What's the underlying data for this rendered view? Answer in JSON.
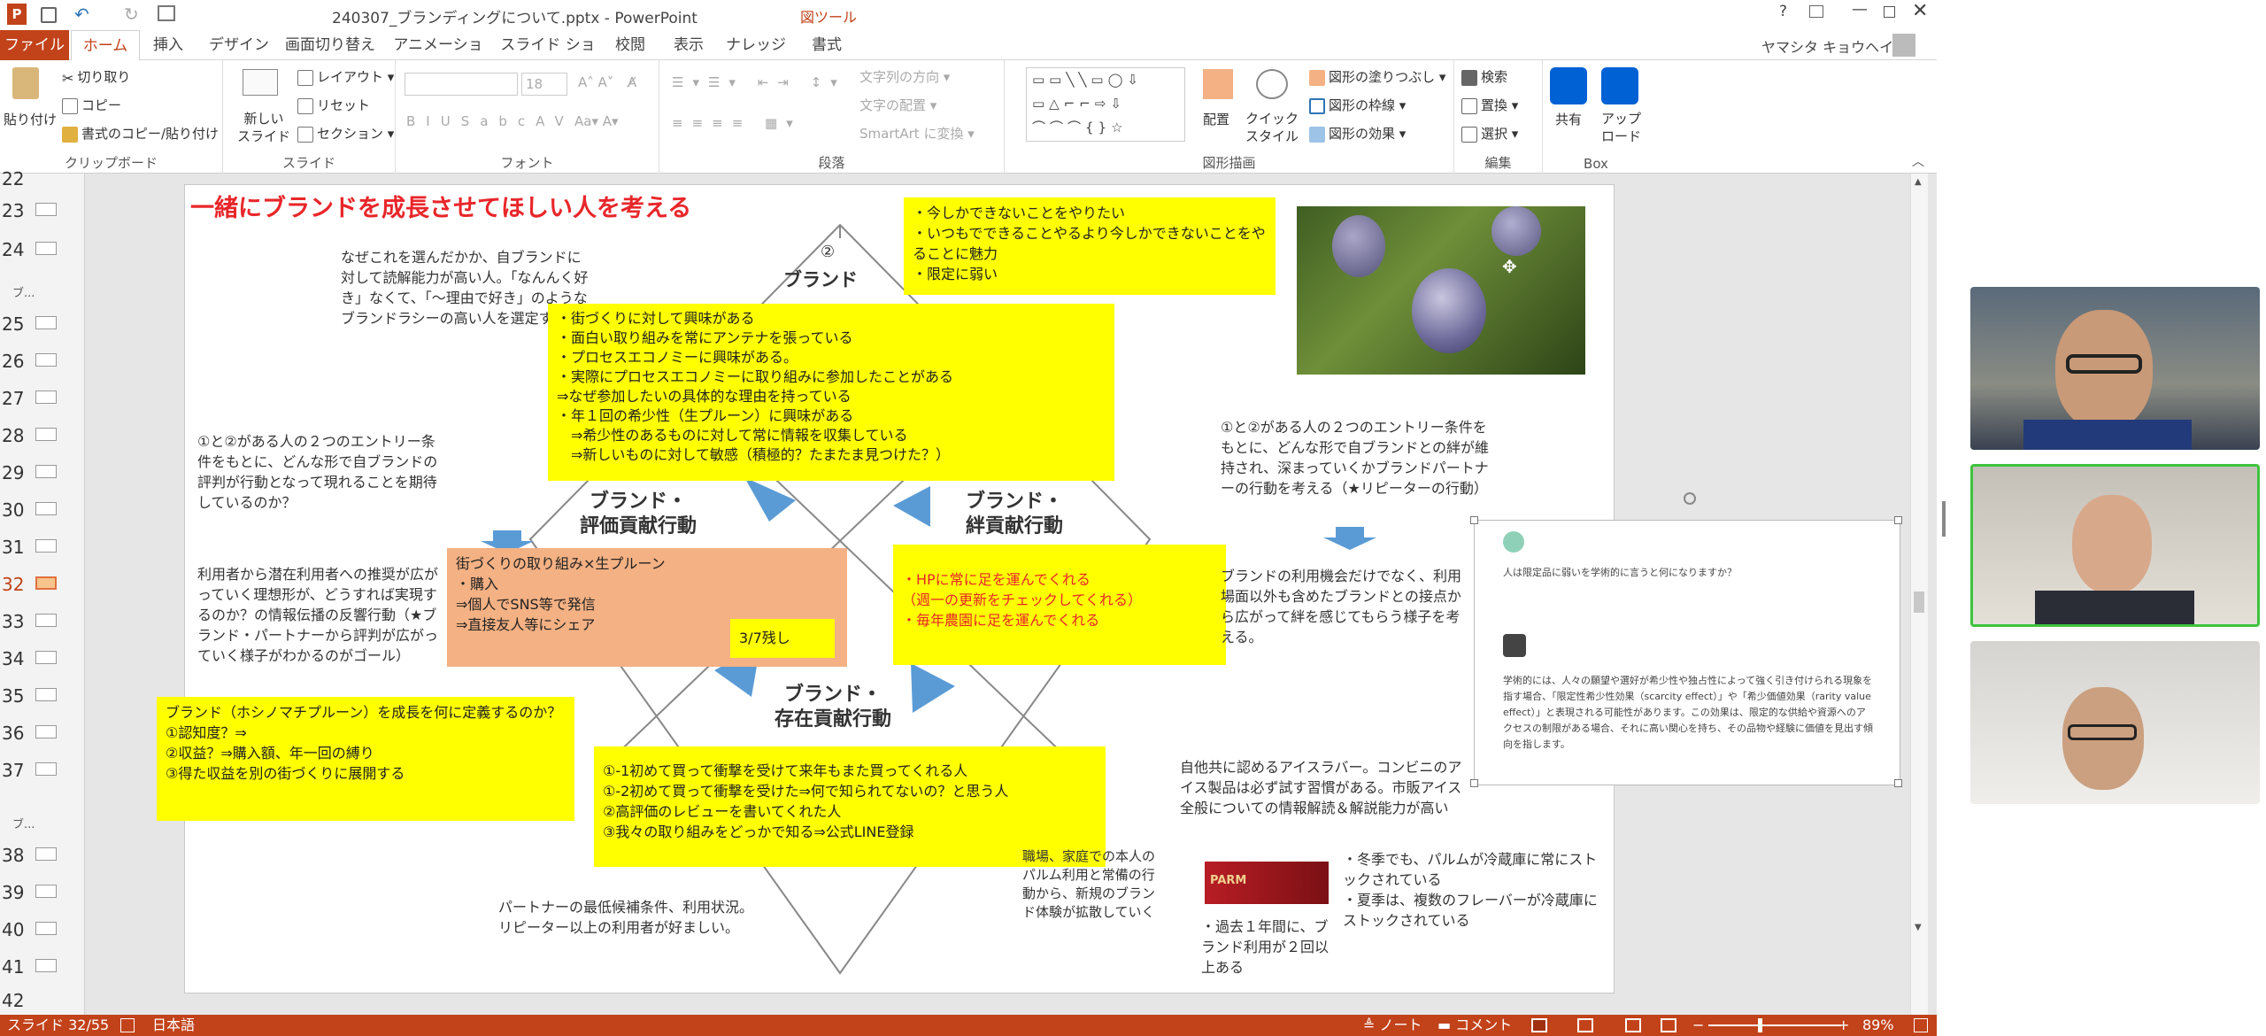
{
  "window": {
    "title": "240307_ブランディングについて.pptx - PowerPoint",
    "context_tab": "図ツール",
    "user": "ヤマシタ キョウヘイ"
  },
  "tabs": [
    "ファイル",
    "ホーム",
    "挿入",
    "デザイン",
    "画面切り替え",
    "アニメーション",
    "スライド ショー",
    "校閲",
    "表示",
    "ナレッジ",
    "書式"
  ],
  "ribbon": {
    "clipboard": {
      "paste": "貼り付け",
      "cut": "切り取り",
      "copy": "コピー",
      "format_painter": "書式のコピー/貼り付け",
      "label": "クリップボード"
    },
    "slides": {
      "new_slide": "新しい\nスライド",
      "layout": "レイアウト",
      "reset": "リセット",
      "section": "セクション",
      "label": "スライド"
    },
    "font": {
      "size": "18",
      "label": "フォント"
    },
    "paragraph": {
      "text_direction": "文字列の方向",
      "align_text": "文字の配置",
      "smartart": "SmartArt に変換",
      "label": "段落"
    },
    "drawing": {
      "arrange": "配置",
      "quick_styles": "クイック\nスタイル",
      "fill": "図形の塗りつぶし",
      "outline": "図形の枠線",
      "effects": "図形の効果",
      "label": "図形描画"
    },
    "editing": {
      "find": "検索",
      "replace": "置換",
      "select": "選択",
      "label": "編集"
    },
    "box": {
      "share": "共有",
      "upload": "アップ\nロード",
      "label": "Box"
    }
  },
  "thumbnails": {
    "numbers": [
      "22",
      "23",
      "24",
      "25",
      "26",
      "27",
      "28",
      "29",
      "30",
      "31",
      "32",
      "33",
      "34",
      "35",
      "36",
      "37",
      "38",
      "39",
      "40",
      "41",
      "42"
    ],
    "section1": "ブ...",
    "section2": "ブ...",
    "current": "32"
  },
  "slide": {
    "title": "一緒にブランドを成長させてほしい人を考える",
    "why": "なぜこれを選んだかか、自ブランドに対して読解能力が高い人。「なんんく好き」なくて、「〜理由で好き」のようなブランドラシーの高い人を選定する",
    "q1": "①と②がある人の２つのエントリー条件をもとに、どんな形で自ブランドの評判が行動となって現れることを期待しているのか？",
    "goal1": "利用者から潜在利用者への推奨が広がっていく理想形が、どうすれば実現するのか？の情報伝播の反響行動（★ブランド・パートナーから評判が広がっていく様子がわかるのがゴール）",
    "yellow_def": "ブランド（ホシノマチプルーン）を成長を何に定義するのか？\n①認知度？⇒\n②収益？⇒購入額、年一回の縛り\n③得た収益を別の街づくりに展開する",
    "partner_min": "パートナーの最低候補条件、利用状況。リピーター以上の利用者が好ましい。",
    "yellow_top": "・今しかできないことをやりたい\n・いつもでできることやるより今しかできないことをやることに魅力\n・限定に弱い",
    "yellow_center": "・街づくりに対して興味がある\n・面白い取り組みを常にアンテナを張っている\n・プロセスエコノミーに興味がある。\n・実際にプロセスエコノミーに取り組みに参加したことがある\n⇒なぜ参加したいの具体的な理由を持っている\n・年１回の希少性（生プルーン）に興味がある\n　⇒希少性のあるものに対して常に情報を収集している\n　⇒新しいものに対して敏感（積極的？たまたま見つけた？）",
    "circle2": "②",
    "brand_top": "ブランド",
    "eval_label": "ブランド・\n評価貢献行動",
    "bond_label": "ブランド・\n絆貢献行動",
    "exist_label": "ブランド・\n存在貢献行動",
    "orange_box": "街づくりの取り組み×生プルーン\n・購入\n⇒個人でSNS等で発信\n⇒直接友人等にシェア",
    "remaining": "3/7残し",
    "yellow_bond": "・HPに常に足を運んでくれる\n（週一の更新をチェックしてくれる）\n・毎年農園に足を運んでくれる",
    "yellow_exist": "①-1初めて買って衝撃を受けて来年もまた買ってくれる人\n①-2初めて買って衝撃を受けた⇒何で知られてないの？と思う人\n②高評価のレビューを書いてくれた人\n③我々の取り組みをどっかで知る⇒公式LINE登録",
    "q2": "①と②がある人の２つのエントリー条件をもとに、どんな形で自ブランドとの絆が維持され、深まっていくかブランドパートナーの行動を考える（★リピーターの行動）",
    "brand_use": "ブランドの利用機会だけでなく、利用場面以外も含めたブランドとの接点から広がって絆を感じてもらう様子を考える。",
    "chat_q": "人は限定品に弱いを学術的に言うと何になりますか？",
    "chat_a": "学術的には、人々の願望や選好が希少性や独占性によって強く引き付けられる現象を指す場合、「限定性希少性効果（scarcity effect）」や「希少価値効果（rarity value effect）」と表現される可能性があります。この効果は、限定的な供給や資源へのアクセスの制限がある場合、それに高い関心を持ち、その品物や経験に価値を見出す傾向を指します。",
    "ice_lover": "自他共に認めるアイスラバー。コンビニのアイス製品は必ず試す習慣がある。市販アイス全般についての情報解読＆解説能力が高い",
    "workplace": "職場、家庭での本人のパルム利用と常備の行動から、新規のブランド体験が拡散していく",
    "parm_label": "PARM",
    "stock": "・冬季でも、パルムが冷蔵庫に常にストックされている\n・夏季は、複数のフレーバーが冷蔵庫にストックされている",
    "past_year": "・過去１年間に、ブランド利用が２回以上ある"
  },
  "status": {
    "slide_info": "スライド 32/55",
    "language": "日本語",
    "notes": "ノート",
    "comments": "コメント",
    "zoom": "89%"
  },
  "colors": {
    "accent": "#c2421a",
    "red_text": "#e8262a",
    "highlight": "#ffff00",
    "orange_box": "#f4b183",
    "arrow": "#5b9bd5"
  }
}
